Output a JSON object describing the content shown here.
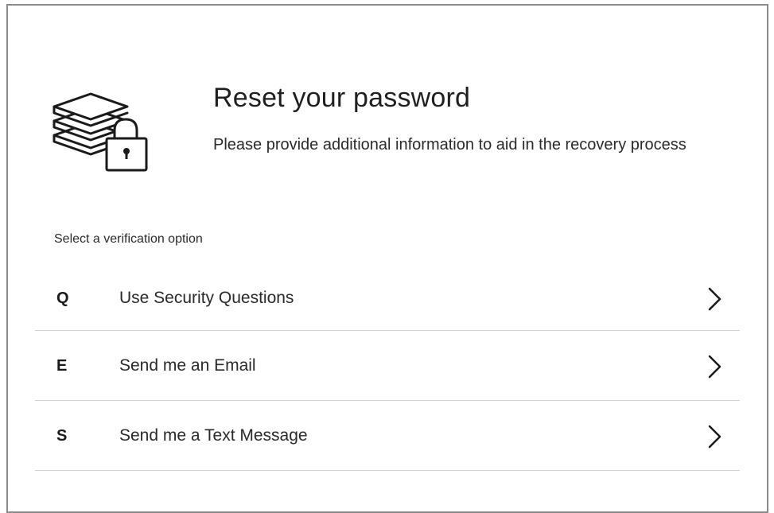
{
  "header": {
    "title": "Reset your password",
    "subtitle": "Please provide additional information to aid in the recovery process",
    "icon": "stacked-layers-lock-icon"
  },
  "verification": {
    "label": "Select a verification option",
    "options": [
      {
        "key": "Q",
        "label": "Use Security Questions",
        "icon": "chevron-right-icon"
      },
      {
        "key": "E",
        "label": "Send me an Email",
        "icon": "chevron-right-icon"
      },
      {
        "key": "S",
        "label": "Send me a Text Message",
        "icon": "chevron-right-icon"
      }
    ]
  },
  "colors": {
    "frame_border": "#8a8a8a",
    "divider": "#d2d2d2",
    "text": "#222222"
  }
}
